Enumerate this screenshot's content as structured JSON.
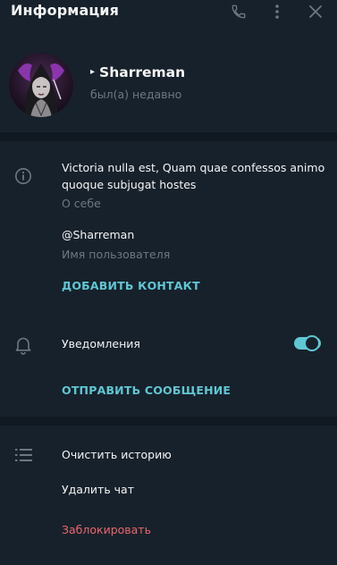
{
  "header": {
    "title": "Информация",
    "icons": [
      "phone-icon",
      "more-vertical-icon",
      "close-icon"
    ]
  },
  "profile": {
    "name": "Sharreman",
    "status": "был(а) недавно"
  },
  "info": {
    "bio": "Victoria nulla est, Quam quae confessos animo quoque subjugat hostes",
    "bio_label": "О себе",
    "username": "@Sharreman",
    "username_label": "Имя пользователя",
    "add_contact": "ДОБАВИТЬ КОНТАКТ"
  },
  "notifications": {
    "label": "Уведомления",
    "enabled": true,
    "send_message": "ОТПРАВИТЬ СООБЩЕНИЕ"
  },
  "actions": {
    "clear_history": "Очистить историю",
    "delete_chat": "Удалить чат",
    "block": "Заблокировать"
  },
  "colors": {
    "background": "#17212b",
    "divider": "#101921",
    "accent": "#5fc7d3",
    "muted": "#6d7883",
    "danger": "#e8676b"
  }
}
